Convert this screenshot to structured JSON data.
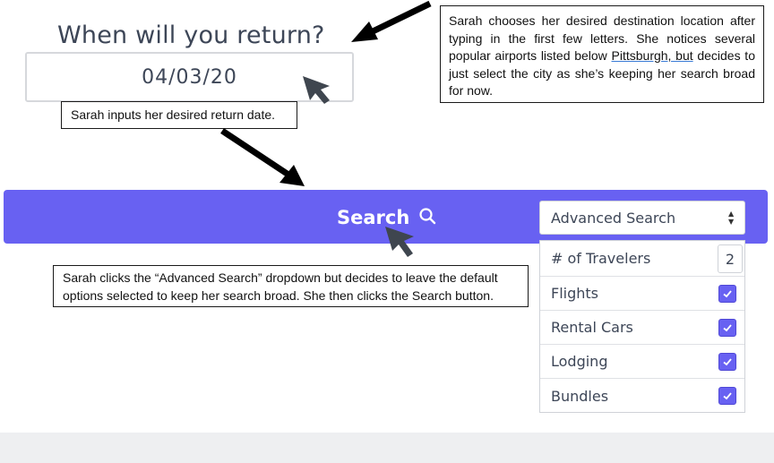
{
  "return_section": {
    "heading": "When will you return?",
    "date_value": "04/03/20"
  },
  "search_bar": {
    "search_label": "Search",
    "advanced_select_value": "Advanced Search",
    "accent_color": "#6861f2"
  },
  "advanced_options": {
    "travelers_label": "# of Travelers",
    "travelers_value": "2",
    "options": [
      {
        "label": "Flights",
        "checked": true
      },
      {
        "label": "Rental Cars",
        "checked": true
      },
      {
        "label": "Lodging",
        "checked": true
      },
      {
        "label": "Bundles",
        "checked": true
      }
    ]
  },
  "annotations": {
    "destination_note_pre": "Sarah chooses her desired destination location after typing in the first few letters. She notices several popular airports listed below ",
    "destination_note_link": "Pittsburgh, but",
    "destination_note_post": " decides to just select the city as she’s keeping her search broad for now.",
    "date_note": "Sarah inputs her desired return date.",
    "search_note": "Sarah clicks the “Advanced Search” dropdown but decides to leave the default options selected to keep her search broad. She then clicks the Search button."
  },
  "icons": {
    "search": "magnifier-icon",
    "select_caret": "updown-caret-icon",
    "checkbox": "check-icon",
    "pointer": "mouse-cursor-icon",
    "arrow": "annotation-arrow-icon"
  }
}
